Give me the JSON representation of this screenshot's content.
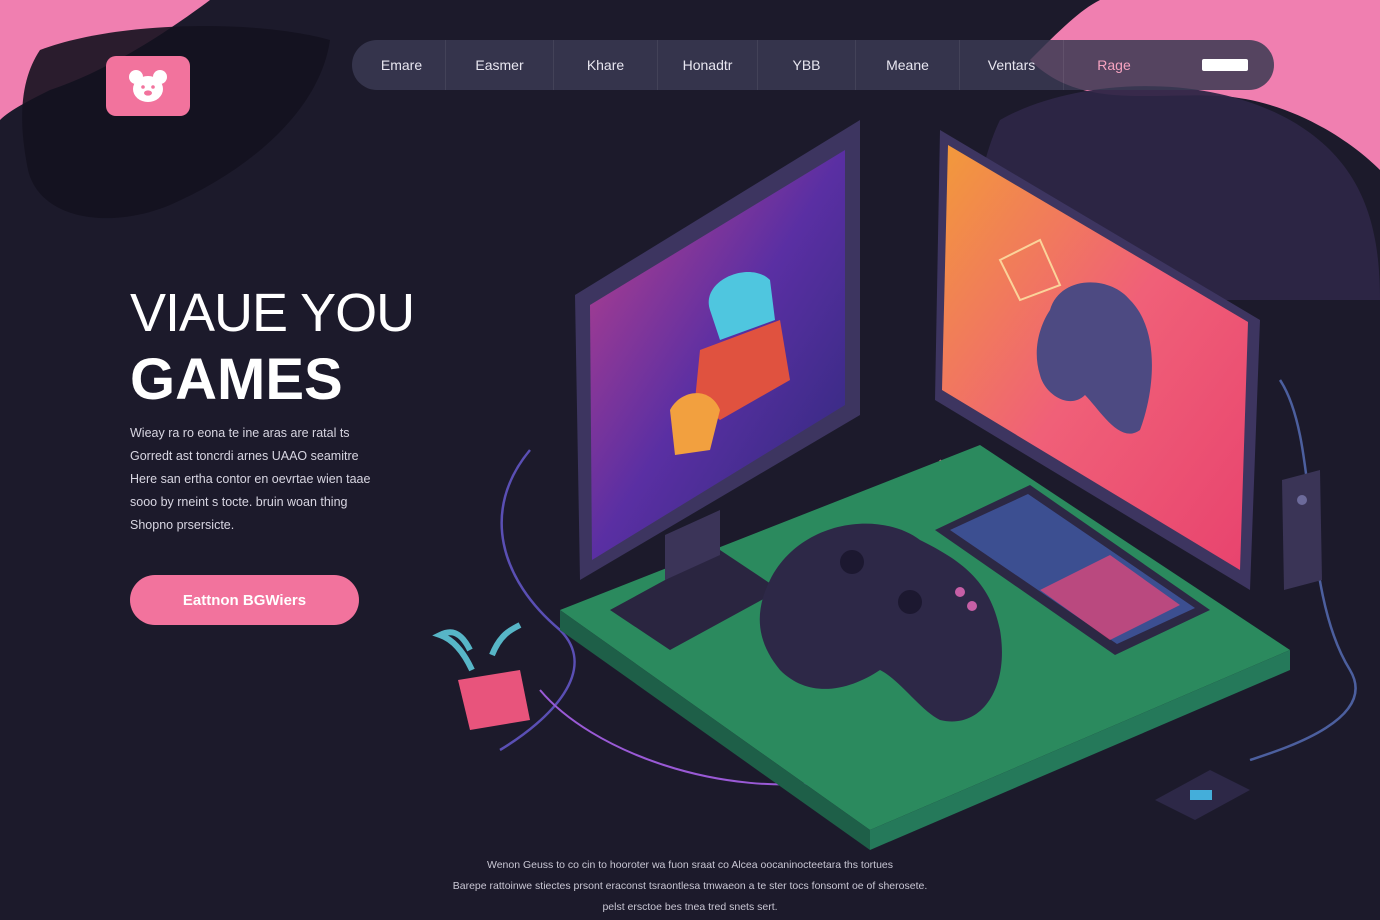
{
  "nav": {
    "items": [
      "Emare",
      "Easmer",
      "Khare",
      "Honadtr",
      "YBB",
      "Meane",
      "Ventars",
      "Rage"
    ]
  },
  "hero": {
    "line1": "VIAUE YOU",
    "line2": "GAMES",
    "description": [
      "Wieay ra ro eona te ine aras are ratal ts",
      "Gorredt ast toncrdi arnes UAAO seamitre",
      "Here san ertha contor en oevrtae wien taae",
      "sooo by rneint s tocte. bruin woan thing",
      "Shopno prsersicte."
    ],
    "cta_label": "Eattnon BGWiers"
  },
  "footer": {
    "lines": [
      "Wenon Geuss to co cin to hooroter wa fuon sraat co Alcea oocaninocteetara ths tortues",
      "Barepe rattoinwe stiectes prsont eraconst tsraontlesa tmwaeon a te ster tocs fonsomt oe of sherosete.",
      "pelst ersctoe bes tnea tred snets sert."
    ]
  },
  "colors": {
    "background": "#1c1a2b",
    "accent_pink": "#f2739d",
    "navbar": "#3a3a52",
    "mat_green": "#3f9a67"
  },
  "icons": [
    "bear-logo-icon"
  ]
}
